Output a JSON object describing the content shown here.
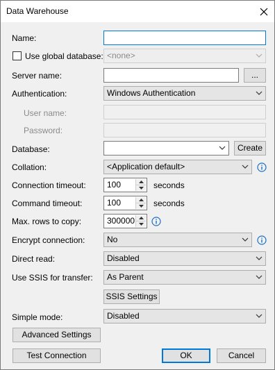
{
  "window": {
    "title": "Data Warehouse"
  },
  "labels": {
    "name": "Name:",
    "use_global_database": "Use global database:",
    "server_name": "Server name:",
    "authentication": "Authentication:",
    "user_name": "User name:",
    "password": "Password:",
    "database": "Database:",
    "collation": "Collation:",
    "connection_timeout": "Connection timeout:",
    "command_timeout": "Command timeout:",
    "max_rows": "Max. rows to copy:",
    "encrypt_connection": "Encrypt connection:",
    "direct_read": "Direct read:",
    "use_ssis": "Use SSIS for transfer:",
    "simple_mode": "Simple mode:"
  },
  "values": {
    "name": "",
    "global_database": "<none>",
    "server_name": "",
    "browse": "...",
    "authentication": "Windows Authentication",
    "user_name": "",
    "password": "",
    "database": "",
    "collation": "<Application default>",
    "connection_timeout": "100",
    "connection_timeout_unit": "seconds",
    "command_timeout": "100",
    "command_timeout_unit": "seconds",
    "max_rows": "300000",
    "encrypt_connection": "No",
    "direct_read": "Disabled",
    "use_ssis": "As Parent",
    "simple_mode": "Disabled"
  },
  "buttons": {
    "create": "Create",
    "ssis_settings": "SSIS Settings",
    "advanced_settings": "Advanced Settings",
    "test_connection": "Test Connection",
    "ok": "OK",
    "cancel": "Cancel"
  },
  "colors": {
    "accent": "#0078d7",
    "info": "#1a6fc9"
  }
}
